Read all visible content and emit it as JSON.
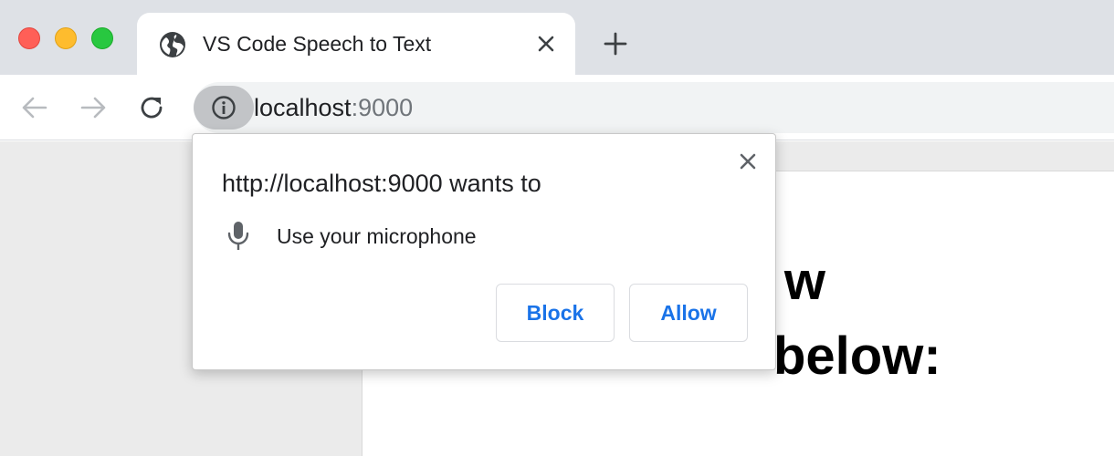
{
  "window": {
    "controls": [
      "close-button",
      "minimize-button",
      "maximize-button"
    ]
  },
  "tab": {
    "title": "VS Code Speech to Text",
    "icon": "globe-icon"
  },
  "toolbar": {
    "url_host": "localhost",
    "url_port": ":9000"
  },
  "page": {
    "heading_line1": "Start speaking, w",
    "heading_line2": "below:"
  },
  "permission_popup": {
    "title": "http://localhost:9000 wants to",
    "permission": "Use your microphone",
    "block_label": "Block",
    "allow_label": "Allow"
  },
  "colors": {
    "accent": "#1a73e8",
    "tabbar": "#dee1e6",
    "close": "#ff5f57",
    "minimize": "#febc2e",
    "maximize": "#28c840"
  }
}
